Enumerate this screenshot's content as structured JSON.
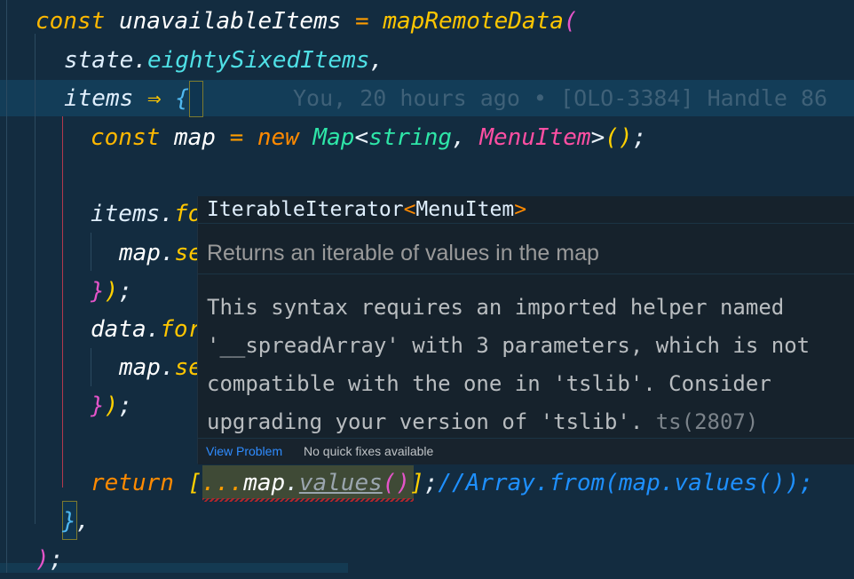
{
  "editor": {
    "lines": [
      {
        "n": 1,
        "tokens": [
          {
            "t": "const",
            "c": "kw"
          },
          {
            "t": " "
          },
          {
            "t": "unavailableItems",
            "c": "var"
          },
          {
            "t": " "
          },
          {
            "t": "=",
            "c": "op"
          },
          {
            "t": " "
          },
          {
            "t": "mapRemoteData",
            "c": "fn"
          },
          {
            "t": "(",
            "c": "b2"
          }
        ]
      },
      {
        "n": 2,
        "tokens": [
          {
            "t": "state",
            "c": "param"
          },
          {
            "t": ".",
            "c": "punc"
          },
          {
            "t": "eightySixedItems",
            "c": "prop"
          },
          {
            "t": ",",
            "c": "punc"
          }
        ]
      },
      {
        "n": 3,
        "tokens": [
          {
            "t": "items",
            "c": "param"
          },
          {
            "t": " "
          },
          {
            "t": "⇒",
            "c": "fn"
          },
          {
            "t": " "
          },
          {
            "t": "{",
            "c": "b3"
          }
        ]
      },
      {
        "n": 4,
        "tokens": [
          {
            "t": "const",
            "c": "kw"
          },
          {
            "t": " "
          },
          {
            "t": "map",
            "c": "var"
          },
          {
            "t": " "
          },
          {
            "t": "=",
            "c": "op"
          },
          {
            "t": " "
          },
          {
            "t": "new",
            "c": "kw2"
          },
          {
            "t": " "
          },
          {
            "t": "Map",
            "c": "type"
          },
          {
            "t": "<",
            "c": "punc"
          },
          {
            "t": "string",
            "c": "type"
          },
          {
            "t": ",",
            "c": "punc"
          },
          {
            "t": " "
          },
          {
            "t": "MenuItem",
            "c": "type2"
          },
          {
            "t": ">",
            "c": "punc"
          },
          {
            "t": "()",
            "c": "b1"
          },
          {
            "t": ";",
            "c": "punc"
          }
        ]
      },
      {
        "n": 5,
        "tokens": []
      },
      {
        "n": 6,
        "tokens": [
          {
            "t": "items",
            "c": "param"
          },
          {
            "t": ".",
            "c": "punc"
          },
          {
            "t": "fo",
            "c": "fn"
          }
        ]
      },
      {
        "n": 7,
        "tokens": [
          {
            "t": "map",
            "c": "var"
          },
          {
            "t": ".",
            "c": "punc"
          },
          {
            "t": "se",
            "c": "fn"
          }
        ]
      },
      {
        "n": 8,
        "tokens": [
          {
            "t": "}",
            "c": "b2"
          },
          {
            "t": ")",
            "c": "b1"
          },
          {
            "t": ";",
            "c": "punc"
          }
        ]
      },
      {
        "n": 9,
        "tokens": [
          {
            "t": "data",
            "c": "var"
          },
          {
            "t": ".",
            "c": "punc"
          },
          {
            "t": "for",
            "c": "fn"
          }
        ]
      },
      {
        "n": 10,
        "tokens": [
          {
            "t": "map",
            "c": "var"
          },
          {
            "t": ".",
            "c": "punc"
          },
          {
            "t": "se",
            "c": "fn"
          }
        ]
      },
      {
        "n": 11,
        "tokens": [
          {
            "t": "}",
            "c": "b2"
          },
          {
            "t": ")",
            "c": "b1"
          },
          {
            "t": ";",
            "c": "punc"
          }
        ]
      },
      {
        "n": 12,
        "tokens": []
      },
      {
        "n": 13,
        "tokens": [
          {
            "t": "return",
            "c": "kw2"
          },
          {
            "t": " "
          },
          {
            "t": "[",
            "c": "b1"
          },
          {
            "t": "...",
            "c": "op"
          },
          {
            "t": "map",
            "c": "var"
          },
          {
            "t": ".",
            "c": "punc"
          },
          {
            "t": "values",
            "c": "dim"
          },
          {
            "t": "()",
            "c": "b2"
          },
          {
            "t": "]",
            "c": "b1"
          },
          {
            "t": ";",
            "c": "punc"
          },
          {
            "t": "//Array.from(map.values());",
            "c": "cmt"
          }
        ]
      },
      {
        "n": 14,
        "tokens": [
          {
            "t": "}",
            "c": "b3"
          },
          {
            "t": ",",
            "c": "punc"
          }
        ]
      },
      {
        "n": 15,
        "tokens": [
          {
            "t": ")",
            "c": "b2"
          },
          {
            "t": ";",
            "c": "punc"
          }
        ]
      }
    ],
    "blame": "You, 20 hours ago • [OLO-3384] Handle 86"
  },
  "hover": {
    "signature_name": "IterableIterator",
    "signature_open": "<",
    "signature_type": "MenuItem",
    "signature_close": ">",
    "doc": "Returns an iterable of values in the map",
    "message_lines": [
      "This syntax requires an imported helper named",
      "'__spreadArray' with 3 parameters, which is not",
      "compatible with the one in 'tslib'. Consider",
      "upgrading your version of 'tslib'."
    ],
    "error_code": "ts(2807)",
    "view_problem": "View Problem",
    "no_quick_fixes": "No quick fixes available"
  },
  "colors": {
    "background": "#132c40",
    "current_line": "#133d58",
    "hover_background": "#16222c",
    "link": "#2f8cff",
    "error": "#b3262b"
  }
}
